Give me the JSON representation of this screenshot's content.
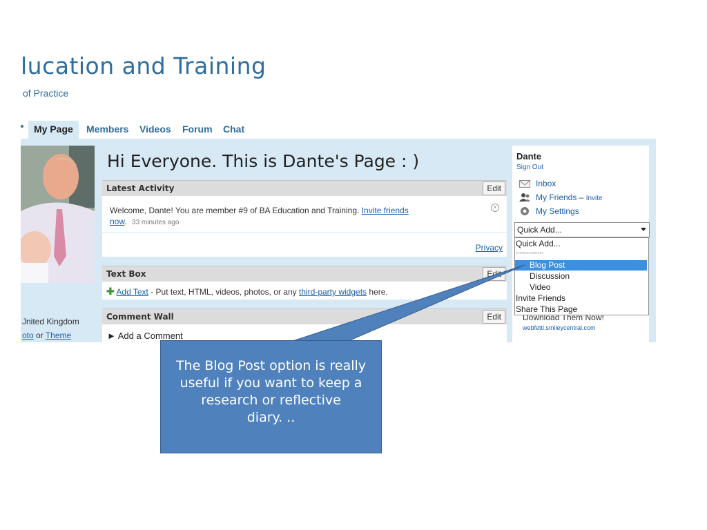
{
  "header": {
    "title": "lucation and Training",
    "subtitle": "of Practice"
  },
  "nav": {
    "items": [
      "My Page",
      "Members",
      "Videos",
      "Forum",
      "Chat"
    ]
  },
  "profile": {
    "location": "Jnited Kingdom",
    "photo_link": "oto",
    "or_text": "or",
    "theme_link": "Theme"
  },
  "main": {
    "heading": "Hi Everyone. This is Dante's Page : )",
    "latest_activity": {
      "title": "Latest Activity",
      "edit": "Edit",
      "message": "Welcome, Dante! You are member #9 of BA Education and Training.",
      "link1": "Invite friends",
      "link2": "now",
      "time": "33 minutes ago",
      "privacy": "Privacy"
    },
    "text_box": {
      "title": "Text Box",
      "edit": "Edit",
      "add_text": "Add Text",
      "desc1": " - Put text, HTML, videos, photos, or any ",
      "widgets_link": "third-party widgets",
      "desc2": " here."
    },
    "comment_wall": {
      "title": "Comment Wall",
      "edit": "Edit",
      "add_comment": "► Add a Comment"
    }
  },
  "user_panel": {
    "name": "Dante",
    "sign_out": "Sign Out",
    "inbox": "Inbox",
    "friends": "My Friends",
    "friends_sep": " – ",
    "invite": "Invite",
    "settings": "My Settings",
    "ad_text": "Download Them Now!",
    "ad_url": "webfetti.smileycentral.com"
  },
  "quick_add": {
    "selected": "Quick Add...",
    "options": [
      "Quick Add...",
      "---------------",
      "Blog Post",
      "Discussion",
      "Video",
      "Invite Friends",
      "Share This Page"
    ],
    "highlighted": "Blog Post"
  },
  "callout": {
    "lines": [
      "The Blog Post option is really",
      "useful if you want to keep a",
      "research or reflective",
      "diary. .."
    ]
  },
  "colors": {
    "accent": "#2e6d9e",
    "content_bg": "#d6e9f5",
    "callout": "#4f81bd",
    "selection": "#3d8fe0"
  }
}
